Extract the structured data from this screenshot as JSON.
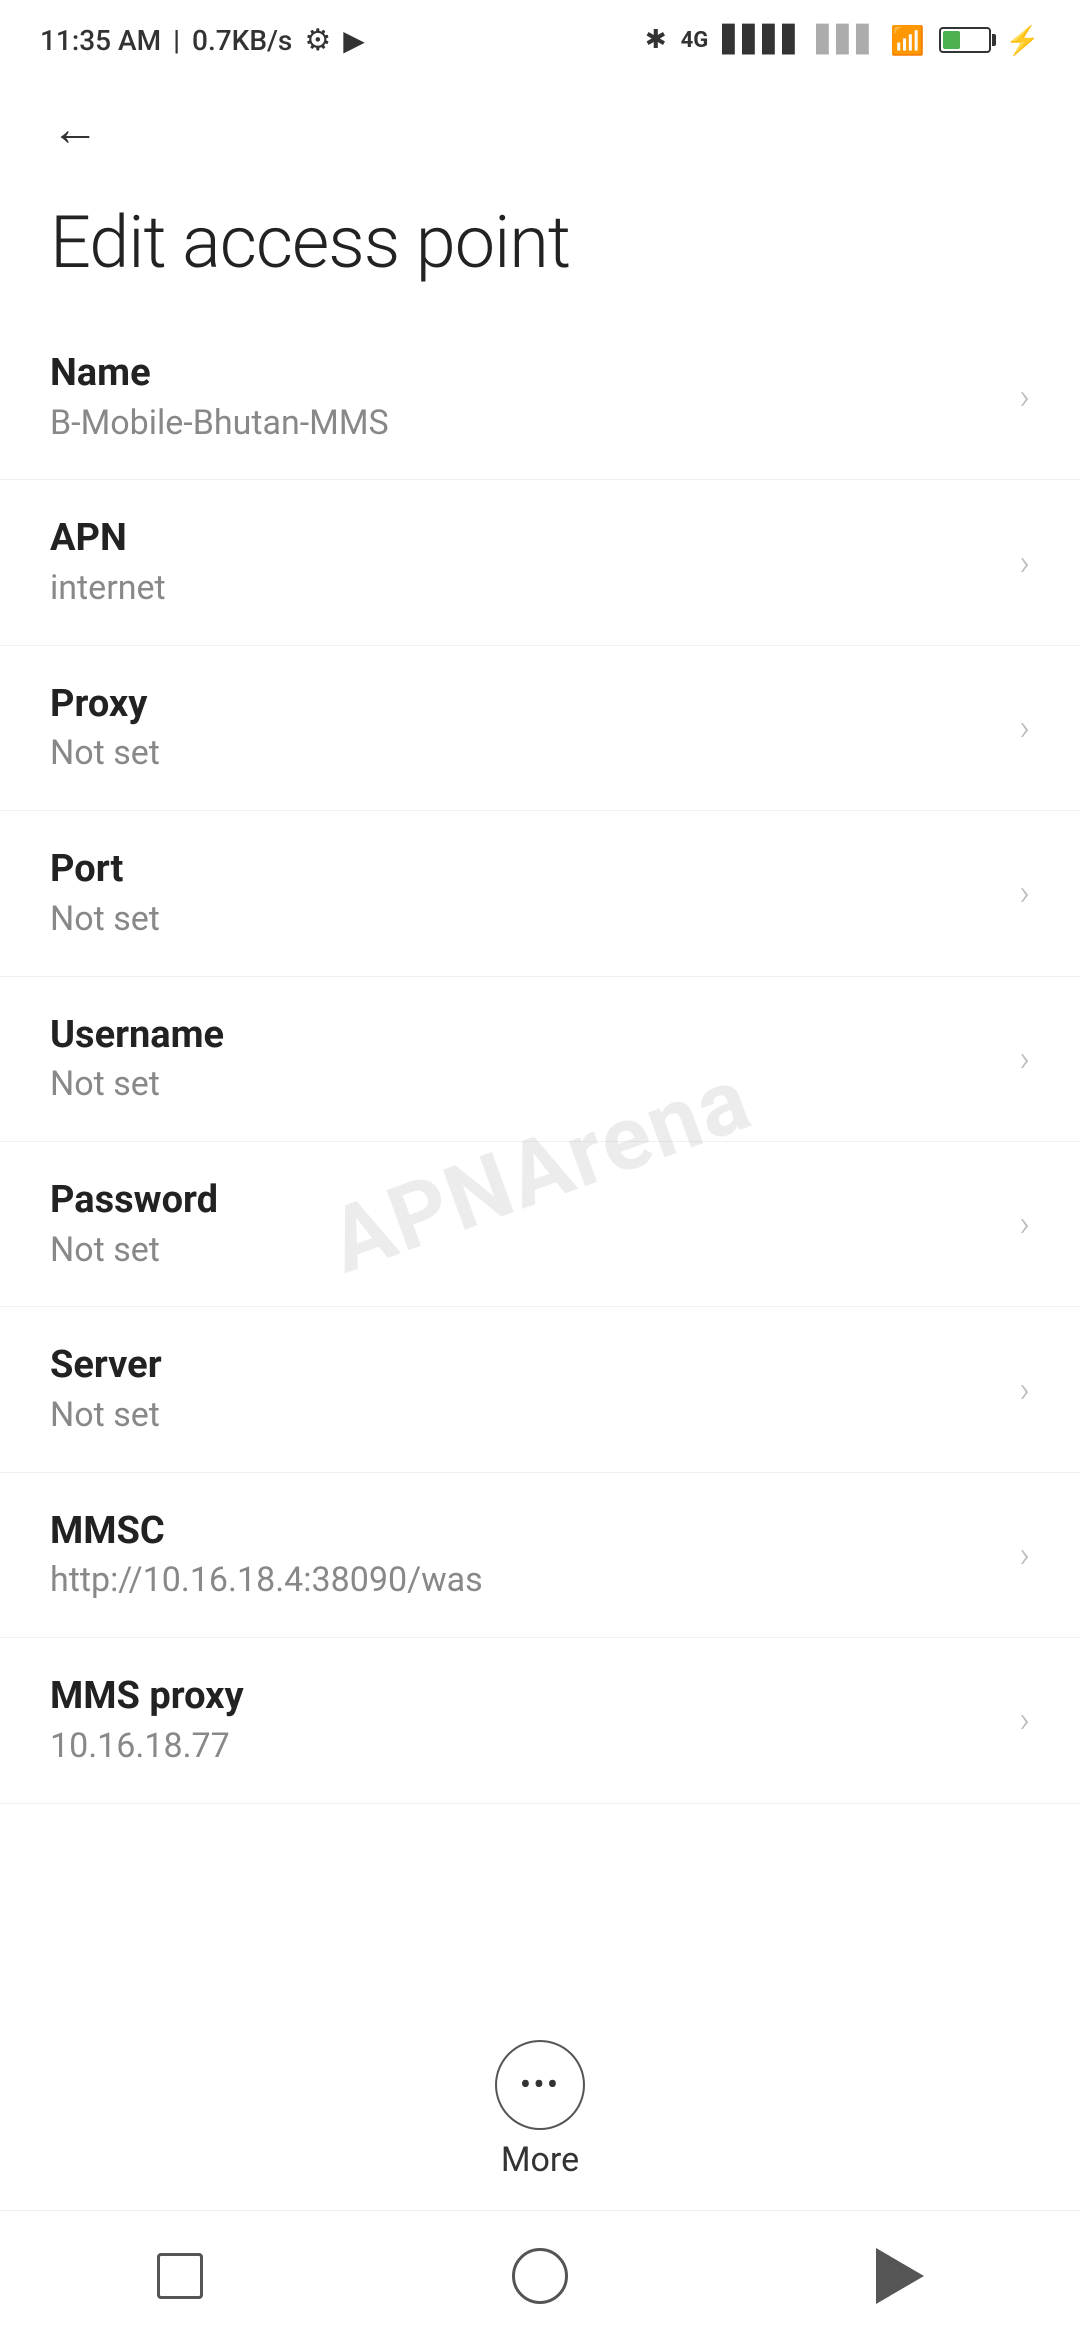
{
  "statusBar": {
    "time": "11:35 AM",
    "speed": "0.7KB/s"
  },
  "header": {
    "backLabel": "←",
    "title": "Edit access point"
  },
  "settings": {
    "items": [
      {
        "label": "Name",
        "value": "B-Mobile-Bhutan-MMS"
      },
      {
        "label": "APN",
        "value": "internet"
      },
      {
        "label": "Proxy",
        "value": "Not set"
      },
      {
        "label": "Port",
        "value": "Not set"
      },
      {
        "label": "Username",
        "value": "Not set"
      },
      {
        "label": "Password",
        "value": "Not set"
      },
      {
        "label": "Server",
        "value": "Not set"
      },
      {
        "label": "MMSC",
        "value": "http://10.16.18.4:38090/was"
      },
      {
        "label": "MMS proxy",
        "value": "10.16.18.77"
      }
    ]
  },
  "watermark": {
    "line1": "APN",
    "line2": "Arena"
  },
  "moreButton": {
    "label": "More"
  },
  "navBar": {
    "square": "recent-apps",
    "circle": "home",
    "triangle": "back"
  }
}
